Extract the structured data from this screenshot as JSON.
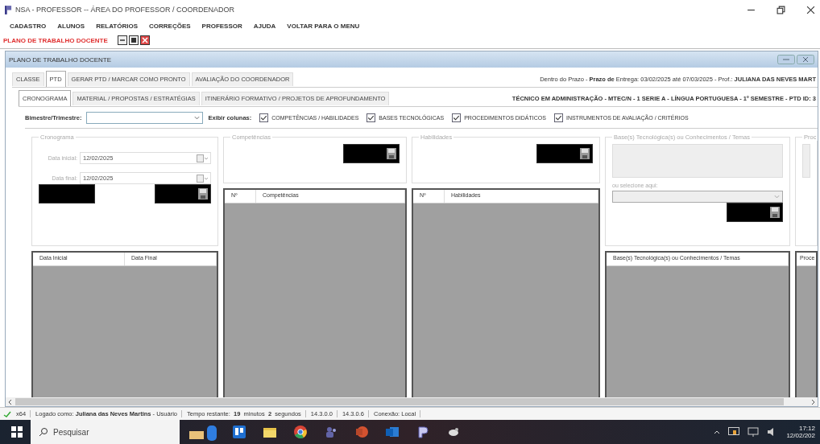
{
  "window": {
    "title": "NSA - PROFESSOR -- ÁREA DO PROFESSOR / COORDENADOR"
  },
  "menu": [
    "CADASTRO",
    "ALUNOS",
    "RELATÓRIOS",
    "CORREÇÕES",
    "PROFESSOR",
    "AJUDA",
    "VOLTAR PARA O MENU"
  ],
  "mdi_tab": {
    "label": "PLANO DE TRABALHO DOCENTE"
  },
  "form": {
    "title": "PLANO DE TRABALHO DOCENTE"
  },
  "tabs": [
    {
      "label": "CLASSE",
      "selected": false
    },
    {
      "label": "PTD",
      "selected": true
    },
    {
      "label": "GERAR PTD / MARCAR COMO PRONTO",
      "selected": false
    },
    {
      "label": "AVALIAÇÃO DO COORDENADOR",
      "selected": false
    }
  ],
  "deadline_info": "Dentro do Prazo  - **Prazo de** Entrega: 03/02/2025 até 07/03/2025 - Prof.: **JULIANA DAS NEVES MART**",
  "subtabs": [
    {
      "label": "CRONOGRAMA",
      "selected": true
    },
    {
      "label": "MATERIAL / PROPOSTAS / ESTRATÉGIAS",
      "selected": false
    },
    {
      "label": "ITINERÁRIO FORMATIVO / PROJETOS DE APROFUNDAMENTO",
      "selected": false
    }
  ],
  "course_info": "TÉCNICO EM ADMINISTRAÇÃO - MTEC/N - 1 SERIE  A - LÍNGUA PORTUGUESA - 1º SEMESTRE - PTD ID: 3",
  "filter": {
    "label": "Bimestre/Trimestre:",
    "columns_label": "Exibir colunas:",
    "columns": [
      {
        "label": "COMPETÊNCIAS / HABILIDADES",
        "checked": true
      },
      {
        "label": "BASES TECNOLÓGICAS",
        "checked": true
      },
      {
        "label": "PROCEDIMENTOS DIDÁTICOS",
        "checked": true
      },
      {
        "label": "INSTRUMENTOS DE AVALIAÇÃO / CRITÉRIOS",
        "checked": true
      }
    ]
  },
  "cronograma": {
    "title": "Cronograma",
    "fields": [
      {
        "label": "Data inicial:",
        "value": "12/02/2025"
      },
      {
        "label": "Data final:",
        "value": "12/02/2025"
      }
    ],
    "grid_columns": [
      "Data Inicial",
      "Data Final"
    ]
  },
  "competencias": {
    "title": "Competências",
    "grid_columns": [
      "Nº",
      "Competências"
    ]
  },
  "habilidades": {
    "title": "Habilidades",
    "grid_columns": [
      "Nº",
      "Habilidades"
    ]
  },
  "bases": {
    "title": "Base(s) Tecnológica(s) ou Conhecimentos / Temas",
    "select_label": "ou selecione aqui:",
    "grid_columns": [
      "Base(s) Tecnológica(s) ou Conhecimentos / Temas"
    ]
  },
  "procedimentos": {
    "title": "Proc",
    "grid_columns": [
      "Proce"
    ]
  },
  "status_bar": [
    "x64",
    "Logado como: **Juliana das Neves Martins** - Usuário",
    "Tempo restante:  **19**  minutos  **2**  segundos",
    "14.3.0.0",
    "14.3.0.6",
    "Conexão: Local"
  ],
  "taskbar": {
    "search_placeholder": "Pesquisar",
    "time": "17:12",
    "date": "12/02/202"
  }
}
